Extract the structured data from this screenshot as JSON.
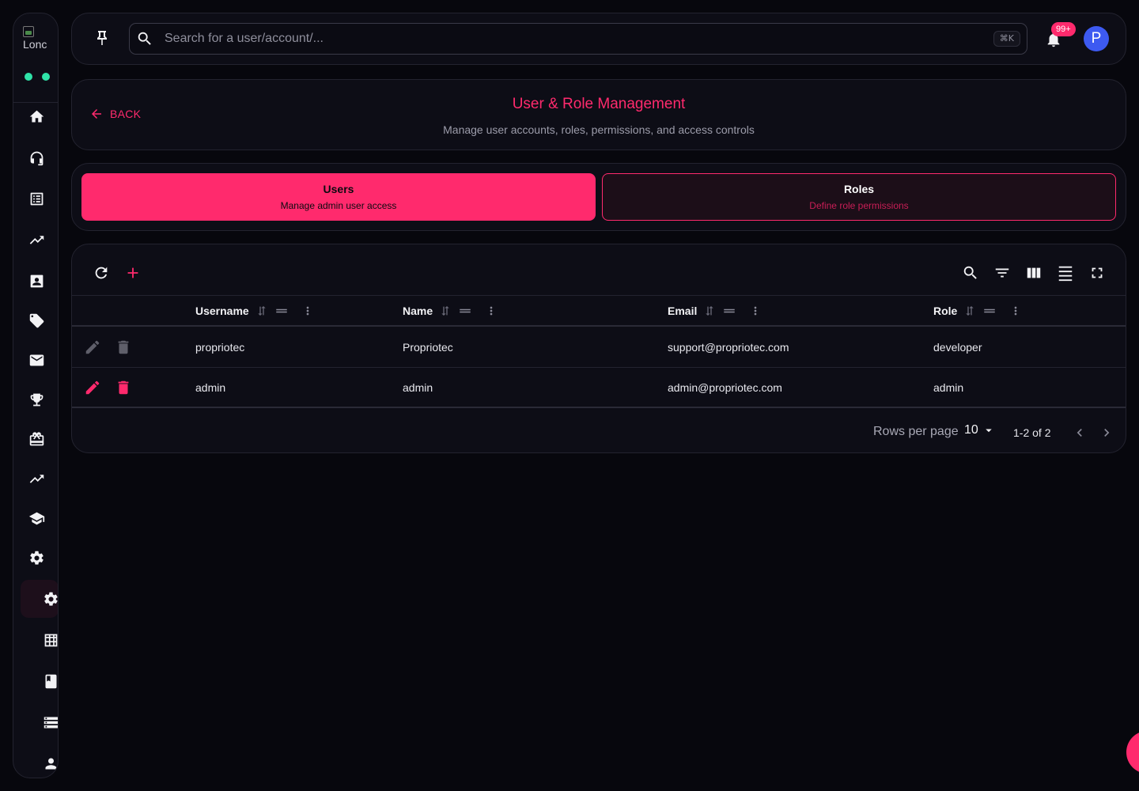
{
  "sidebar": {
    "logo_alt": "Lonc",
    "status_dots": [
      "#2fe3a8",
      "#2fe3a8"
    ],
    "items": [
      {
        "icon": "home-icon"
      },
      {
        "icon": "headset-icon"
      },
      {
        "icon": "list-alt-icon"
      },
      {
        "icon": "trending-up-icon"
      },
      {
        "icon": "contact-card-icon"
      },
      {
        "icon": "tag-icon"
      },
      {
        "icon": "mail-icon"
      },
      {
        "icon": "trophy-icon"
      },
      {
        "icon": "gift-card-icon"
      },
      {
        "icon": "trending-up-icon"
      },
      {
        "icon": "school-icon"
      },
      {
        "icon": "settings-icon"
      },
      {
        "icon": "settings-icon",
        "active": true
      },
      {
        "icon": "grid-icon"
      },
      {
        "icon": "book-icon"
      },
      {
        "icon": "storage-icon"
      },
      {
        "icon": "person-icon"
      }
    ]
  },
  "topbar": {
    "search_placeholder": "Search for a user/account/...",
    "search_value": "",
    "shortcut": "⌘K",
    "notification_count": "99+",
    "avatar_initial": "P"
  },
  "header": {
    "back_label": "BACK",
    "title": "User & Role Management",
    "subtitle": "Manage user accounts, roles, permissions, and access controls"
  },
  "tabs": [
    {
      "label": "Users",
      "sub": "Manage admin user access",
      "active": true
    },
    {
      "label": "Roles",
      "sub": "Define role permissions",
      "active": false
    }
  ],
  "table": {
    "columns": [
      "Username",
      "Name",
      "Email",
      "Role"
    ],
    "rows": [
      {
        "username": "propriotec",
        "name": "Propriotec",
        "email": "support@propriotec.com",
        "role": "developer",
        "actions_enabled": false
      },
      {
        "username": "admin",
        "name": "admin",
        "email": "admin@propriotec.com",
        "role": "admin",
        "actions_enabled": true
      }
    ],
    "rows_per_page_label": "Rows per page",
    "rows_per_page": "10",
    "range": "1-2 of 2"
  },
  "colors": {
    "accent": "#ff2a6d",
    "status_online": "#2fe3a8",
    "avatar": "#3d5af1",
    "disabled_icon": "#5f5f6a"
  }
}
